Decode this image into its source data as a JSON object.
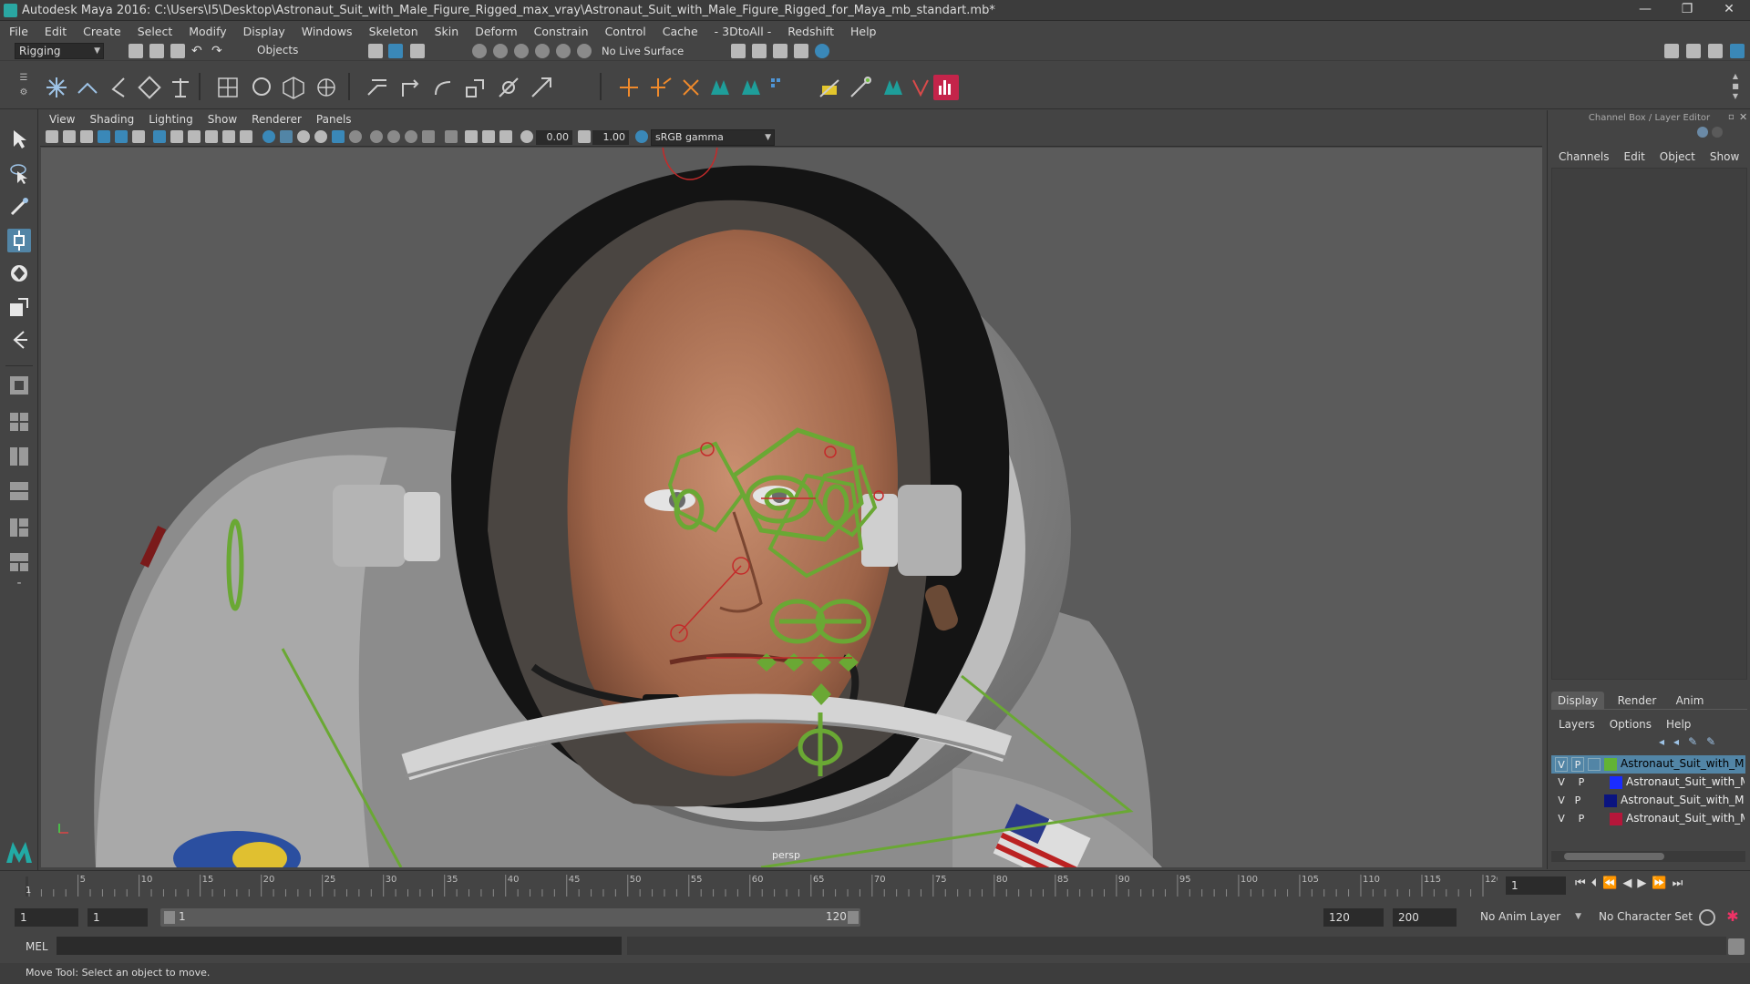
{
  "window": {
    "title": "Autodesk Maya 2016: C:\\Users\\I5\\Desktop\\Astronaut_Suit_with_Male_Figure_Rigged_max_vray\\Astronaut_Suit_with_Male_Figure_Rigged_for_Maya_mb_standart.mb*",
    "controls": [
      "—",
      "❐",
      "✕"
    ]
  },
  "menubar": [
    "File",
    "Edit",
    "Create",
    "Select",
    "Modify",
    "Display",
    "Windows",
    "Skeleton",
    "Skin",
    "Deform",
    "Constrain",
    "Control",
    "Cache",
    "- 3DtoAll -",
    "Redshift",
    "Help"
  ],
  "statusline": {
    "mode": "Rigging",
    "selection_mode": "Objects",
    "live_surface": "No Live Surface"
  },
  "viewport": {
    "menu": [
      "View",
      "Shading",
      "Lighting",
      "Show",
      "Renderer",
      "Panels"
    ],
    "exposure": "0.00",
    "gamma": "1.00",
    "color_space": "sRGB gamma",
    "camera": "persp"
  },
  "channelbox": {
    "title": "Channel Box / Layer Editor",
    "menu": [
      "Channels",
      "Edit",
      "Object",
      "Show"
    ],
    "tabs": [
      "Display",
      "Render",
      "Anim"
    ],
    "active_tab": "Display",
    "layer_menu": [
      "Layers",
      "Options",
      "Help"
    ],
    "layers": [
      {
        "v": "V",
        "p": "P",
        "name": "Astronaut_Suit_with_Mal",
        "color": "#62b335",
        "selected": true
      },
      {
        "v": "V",
        "p": "P",
        "name": "Astronaut_Suit_with_M",
        "color": "#1a2cff",
        "selected": false
      },
      {
        "v": "V",
        "p": "P",
        "name": "Astronaut_Suit_with_Ma",
        "color": "#0a1480",
        "selected": false
      },
      {
        "v": "V",
        "p": "P",
        "name": "Astronaut_Suit_with_M",
        "color": "#b5163a",
        "selected": false
      }
    ]
  },
  "timeline": {
    "ticks": [
      "5",
      "10",
      "15",
      "20",
      "25",
      "30",
      "35",
      "40",
      "45",
      "50",
      "55",
      "60",
      "65",
      "70",
      "75",
      "80",
      "85",
      "90",
      "95",
      "100",
      "105",
      "110",
      "115",
      "120"
    ],
    "start_label": "1",
    "current_frame": "1"
  },
  "range": {
    "start": "1",
    "playback_start": "1",
    "slider_start": "1",
    "slider_end": "120",
    "playback_end": "120",
    "end": "200",
    "anim_layer": "No Anim Layer",
    "char_set": "No Character Set"
  },
  "cmdline": {
    "lang": "MEL"
  },
  "helpline": {
    "text": "Move Tool: Select an object to move."
  }
}
